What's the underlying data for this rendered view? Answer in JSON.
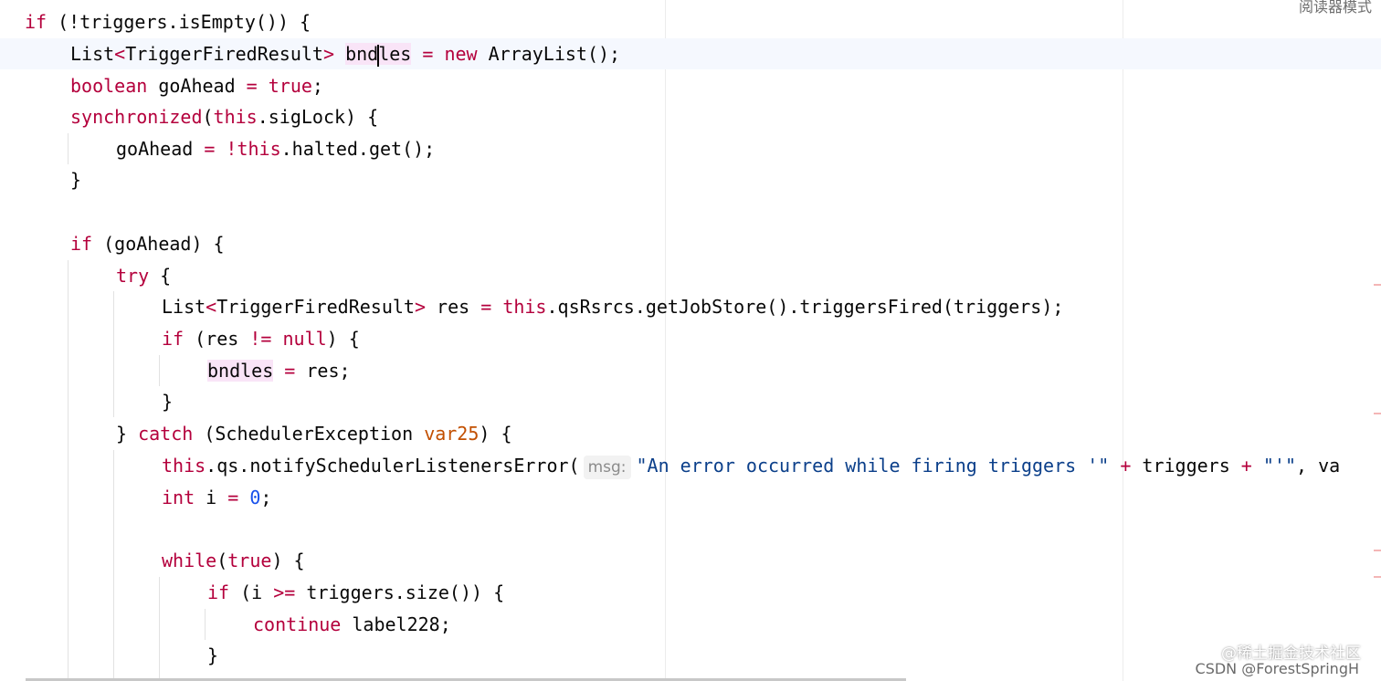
{
  "toolbar": {
    "reader_mode": "阅读器模式"
  },
  "watermarks": {
    "site": "@稀土掘金技术社区",
    "author": "CSDN @ForestSpringH"
  },
  "code": {
    "l1": {
      "if": "if",
      "cond": " (!triggers.isEmpty()) {"
    },
    "l2": {
      "type": "List",
      "gen_open": "<",
      "gen_type": "TriggerFiredResult",
      "gen_close": ">",
      "var_a": "bnd",
      "var_b": "les",
      "eq": " = ",
      "new": "new",
      "rest": " ArrayList();"
    },
    "l3": {
      "kw": "boolean",
      "name": " goAhead",
      "eq": " = ",
      "val": "true",
      "end": ";"
    },
    "l4": {
      "kw": "synchronized",
      "p1": "(",
      "this": "this",
      "rest": ".sigLock) {"
    },
    "l5": {
      "name": "goAhead",
      "eq": " = ",
      "not": "!",
      "this": "this",
      "rest": ".halted.get();"
    },
    "l6": {
      "text": "}"
    },
    "l7": {
      "if": "if",
      "rest": " (goAhead) {"
    },
    "l8": {
      "try": "try",
      "rest": " {"
    },
    "l9": {
      "type": "List",
      "gen_open": "<",
      "gen_type": "TriggerFiredResult",
      "gen_close": ">",
      "var": " res",
      "eq": " = ",
      "this": "this",
      "rest": ".qsRsrcs.getJobStore().triggersFired(triggers);"
    },
    "l10": {
      "if": "if",
      "p1": " (res ",
      "ne": "!=",
      "sp": " ",
      "null": "null",
      "rest": ") {"
    },
    "l11": {
      "var": "bndles",
      "eq": " = ",
      "rest": "res;"
    },
    "l12": {
      "text": "}"
    },
    "l13": {
      "close": "} ",
      "catch": "catch",
      "p1": " (SchedulerException ",
      "param": "var25",
      "rest": ") {"
    },
    "l14": {
      "this": "this",
      "call": ".qs.notifySchedulerListenersError(",
      "hint": "msg:",
      "str1": "\"An error occurred while firing triggers '\"",
      "plus1": " + ",
      "arg": "triggers",
      "plus2": " + ",
      "str2": "\"'\"",
      "rest": ", va"
    },
    "l15": {
      "kw": "int",
      "name": " i",
      "eq": " = ",
      "val": "0",
      "end": ";"
    },
    "l16": {
      "while": "while",
      "p1": "(",
      "true": "true",
      "rest": ") {"
    },
    "l17": {
      "if": "if",
      "p1": " (i ",
      "ge": ">=",
      "rest": " triggers.size()) {"
    },
    "l18": {
      "kw": "continue",
      "rest": " label228;"
    },
    "l19": {
      "text": "}"
    }
  },
  "colors": {
    "keyword": "#0033b3",
    "purple": "#871094",
    "highlight": "#f9e4f7",
    "current_line": "#f5f8fe"
  }
}
